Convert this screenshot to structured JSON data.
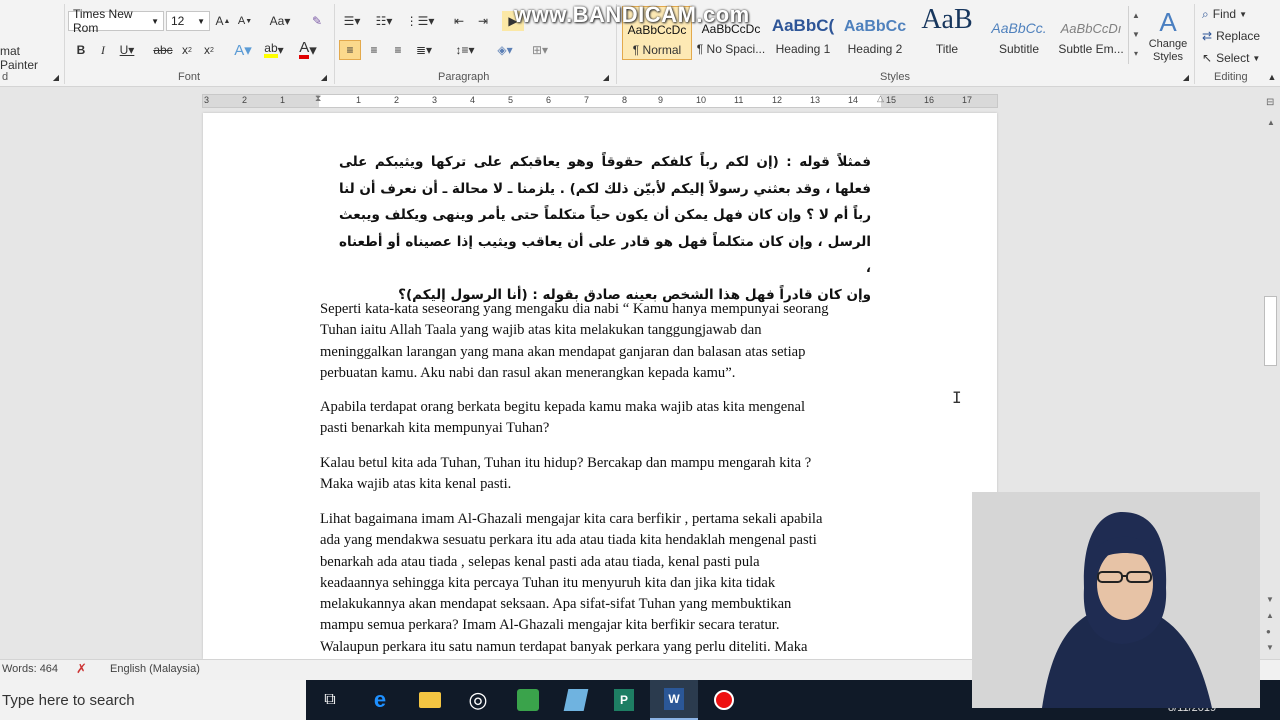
{
  "ribbon": {
    "format_painter": "mat Painter",
    "font_name": "Times New Rom",
    "font_size": "12",
    "groups": {
      "clipboard": "d",
      "font": "Font",
      "paragraph": "Paragraph",
      "styles": "Styles",
      "editing": "Editing"
    },
    "styles": [
      {
        "preview": "AaBbCcDc",
        "name": "¶ Normal"
      },
      {
        "preview": "AaBbCcDc",
        "name": "¶ No Spaci..."
      },
      {
        "preview": "AaBbC(",
        "name": "Heading 1"
      },
      {
        "preview": "AaBbCc",
        "name": "Heading 2"
      },
      {
        "preview": "AaB",
        "name": "Title"
      },
      {
        "preview": "AaBbCc.",
        "name": "Subtitle"
      },
      {
        "preview": "AaBbCcDı",
        "name": "Subtle Em..."
      }
    ],
    "change_styles": "Change Styles",
    "find": "Find",
    "replace": "Replace",
    "select": "Select",
    "watermark": "www.BANDICAM.com"
  },
  "ruler": {
    "ticks": [
      "3",
      "2",
      "1",
      "1",
      "2",
      "3",
      "4",
      "5",
      "6",
      "7",
      "8",
      "9",
      "10",
      "11",
      "12",
      "13",
      "14",
      "15",
      "16",
      "17"
    ]
  },
  "document": {
    "arabic_lines": [
      "فمثلاً قوله : (إن لكم رباً كلفكم حقوقاً وهو يعاقبكم على تركها ويثيبكم على",
      "فعلها ، وقد بعثني رسولاً إليكم لأبيّن ذلك لكم) . يلزمنا ـ لا محالة ـ أن نعرف أن لنا",
      "رباً أم لا ؟ وإن كان فهل يمكن أن يكون حياً متكلماً حتى يأمر وينهى ويكلف ويبعث",
      "الرسل ، وإن كان متكلماً فهل هو قادر على أن يعاقب ويثيب إذا عصيناه أو أطعناه ،",
      "وإن كان قادراً فهل هذا الشخص بعينه صادق بقوله : (أنا الرسول إليكم)؟"
    ],
    "para1": "Seperti kata-kata seseorang yang mengaku dia nabi “ Kamu hanya mempunyai  seorang\nTuhan iaitu Allah Taala yang wajib atas kita melakukan tanggungjawab dan\nmeninggalkan larangan yang mana akan mendapat ganjaran dan balasan atas setiap\nperbuatan kamu. Aku nabi dan rasul akan menerangkan kepada kamu”.",
    "para2": "Apabila terdapat orang berkata begitu kepada kamu maka wajib atas kita mengenal\npasti benarkah kita mempunyai Tuhan?",
    "para3": "Kalau betul kita ada Tuhan, Tuhan itu hidup? Bercakap dan mampu mengarah kita ?\nMaka wajib atas kita kenal pasti.",
    "para4": "Lihat bagaimana imam  Al-Ghazali mengajar kita cara berfikir , pertama sekali  apabila\nada yang mendakwa sesuatu perkara itu ada atau tiada kita hendaklah mengenal  pasti\nbenarkah ada atau tiada , selepas kenal pasti ada atau tiada, kenal pasti pula\nkeadaannya sehingga kita percaya Tuhan itu menyuruh kita dan jika kita tidak\nmelakukannya akan mendapat seksaan. Apa sifat-sifat Tuhan yang membuktikan\nmampu semua perkara? Imam Al-Ghazali mengajar kita berfikir secara teratur.\nWalaupun perkara itu satu namun terdapat banyak perkara yang perlu diteliti. Maka"
  },
  "status": {
    "words": "Words: 464",
    "language": "English (Malaysia)"
  },
  "taskbar": {
    "search_placeholder": "Type here to search",
    "date": "8/11/2019"
  }
}
